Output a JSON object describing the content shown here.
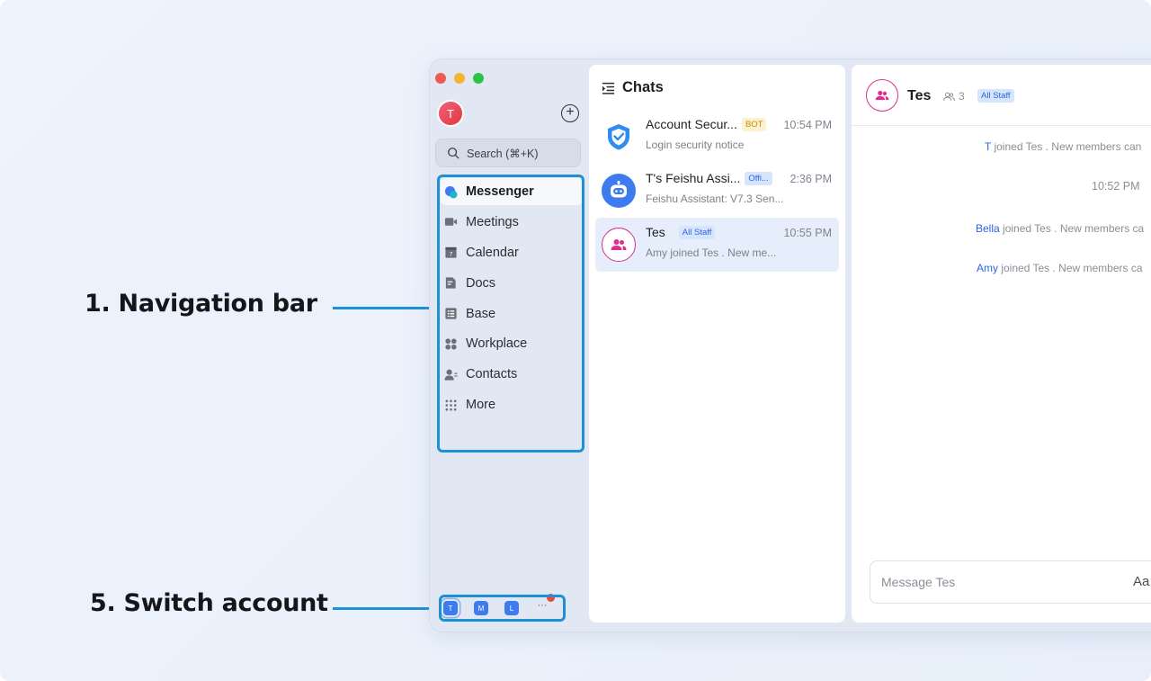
{
  "callouts": {
    "navigation": "1. Navigation bar",
    "switch_account": "5. Switch account"
  },
  "colors": {
    "accent": "#1f8fd6",
    "brand_blue": "#3d7cf0",
    "group_pink": "#e12c8e"
  },
  "sidebar": {
    "avatar_initial": "T",
    "add_icon": "plus-circle-icon",
    "search_placeholder": "Search (⌘+K)",
    "nav_items": [
      {
        "label": "Messenger",
        "icon": "messenger-icon",
        "active": true
      },
      {
        "label": "Meetings",
        "icon": "video-camera-icon"
      },
      {
        "label": "Calendar",
        "icon": "calendar-icon"
      },
      {
        "label": "Docs",
        "icon": "docs-icon"
      },
      {
        "label": "Base",
        "icon": "base-table-icon"
      },
      {
        "label": "Workplace",
        "icon": "workplace-grid-icon"
      },
      {
        "label": "Contacts",
        "icon": "contacts-icon"
      },
      {
        "label": "More",
        "icon": "more-dots-icon"
      }
    ],
    "accounts": [
      "T",
      "M",
      "L"
    ],
    "accounts_more": "···"
  },
  "chatlist": {
    "title": "Chats",
    "items": [
      {
        "name": "Account Secur...",
        "badge": "BOT",
        "time": "10:54 PM",
        "preview": "Login security notice"
      },
      {
        "name": "T's Feishu Assi...",
        "badge": "Offi...",
        "time": "2:36 PM",
        "preview": "Feishu Assistant: V7.3 Sen..."
      },
      {
        "name": "Tes",
        "badge": "All Staff",
        "time": "10:55 PM",
        "preview": "Amy joined Tes . New me...",
        "selected": true
      }
    ]
  },
  "conversation": {
    "title": "Tes",
    "member_count": "3",
    "badge": "All Staff",
    "messages": [
      {
        "who": "T",
        "text": " joined Tes . New members can"
      },
      {
        "time": "10:52 PM"
      },
      {
        "who": "Bella",
        "text": " joined Tes . New members ca"
      },
      {
        "who": "Amy",
        "text": " joined Tes . New members ca"
      }
    ],
    "input_placeholder": "Message Tes",
    "format_label": "Aa"
  }
}
